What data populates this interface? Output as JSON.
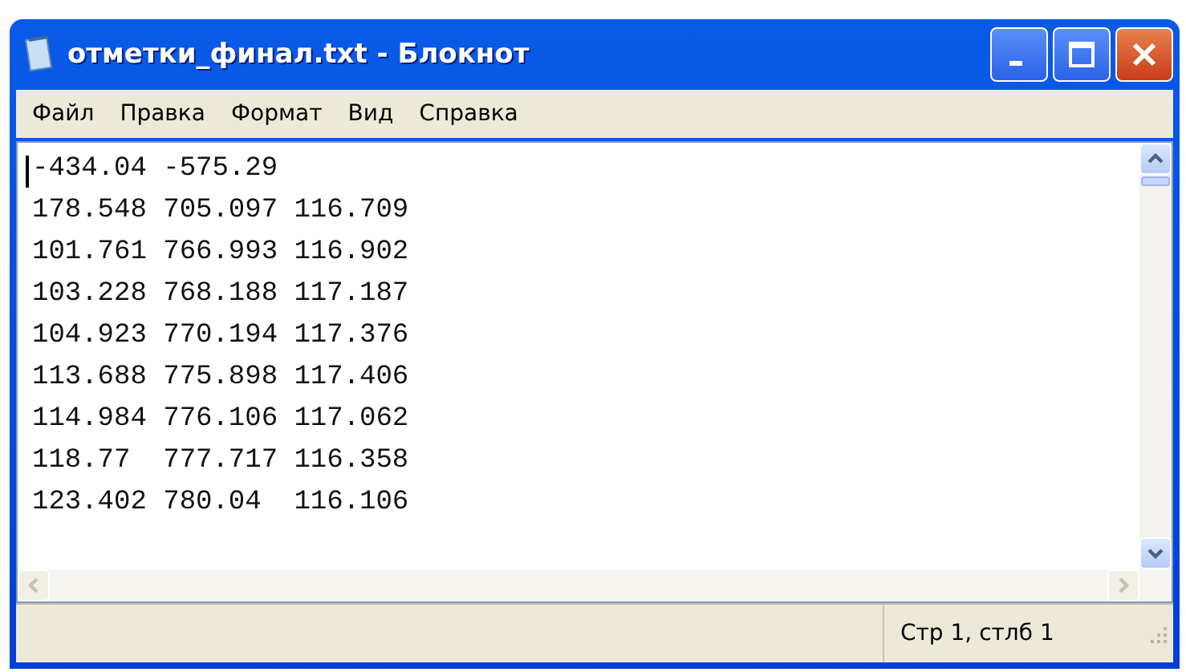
{
  "window": {
    "title": "отметки_финал.txt - Блокнот"
  },
  "menu": [
    {
      "label": "Файл"
    },
    {
      "label": "Правка"
    },
    {
      "label": "Формат"
    },
    {
      "label": "Вид"
    },
    {
      "label": "Справка"
    }
  ],
  "editor": {
    "lines": [
      "-434.04 -575.29",
      "178.548 705.097 116.709",
      "101.761 766.993 116.902",
      "103.228 768.188 117.187",
      "104.923 770.194 117.376",
      "113.688 775.898 117.406",
      "114.984 776.106 117.062",
      "118.77  777.717 116.358",
      "123.402 780.04  116.106"
    ]
  },
  "status_bar": {
    "position": "Стр 1, стлб 1"
  }
}
